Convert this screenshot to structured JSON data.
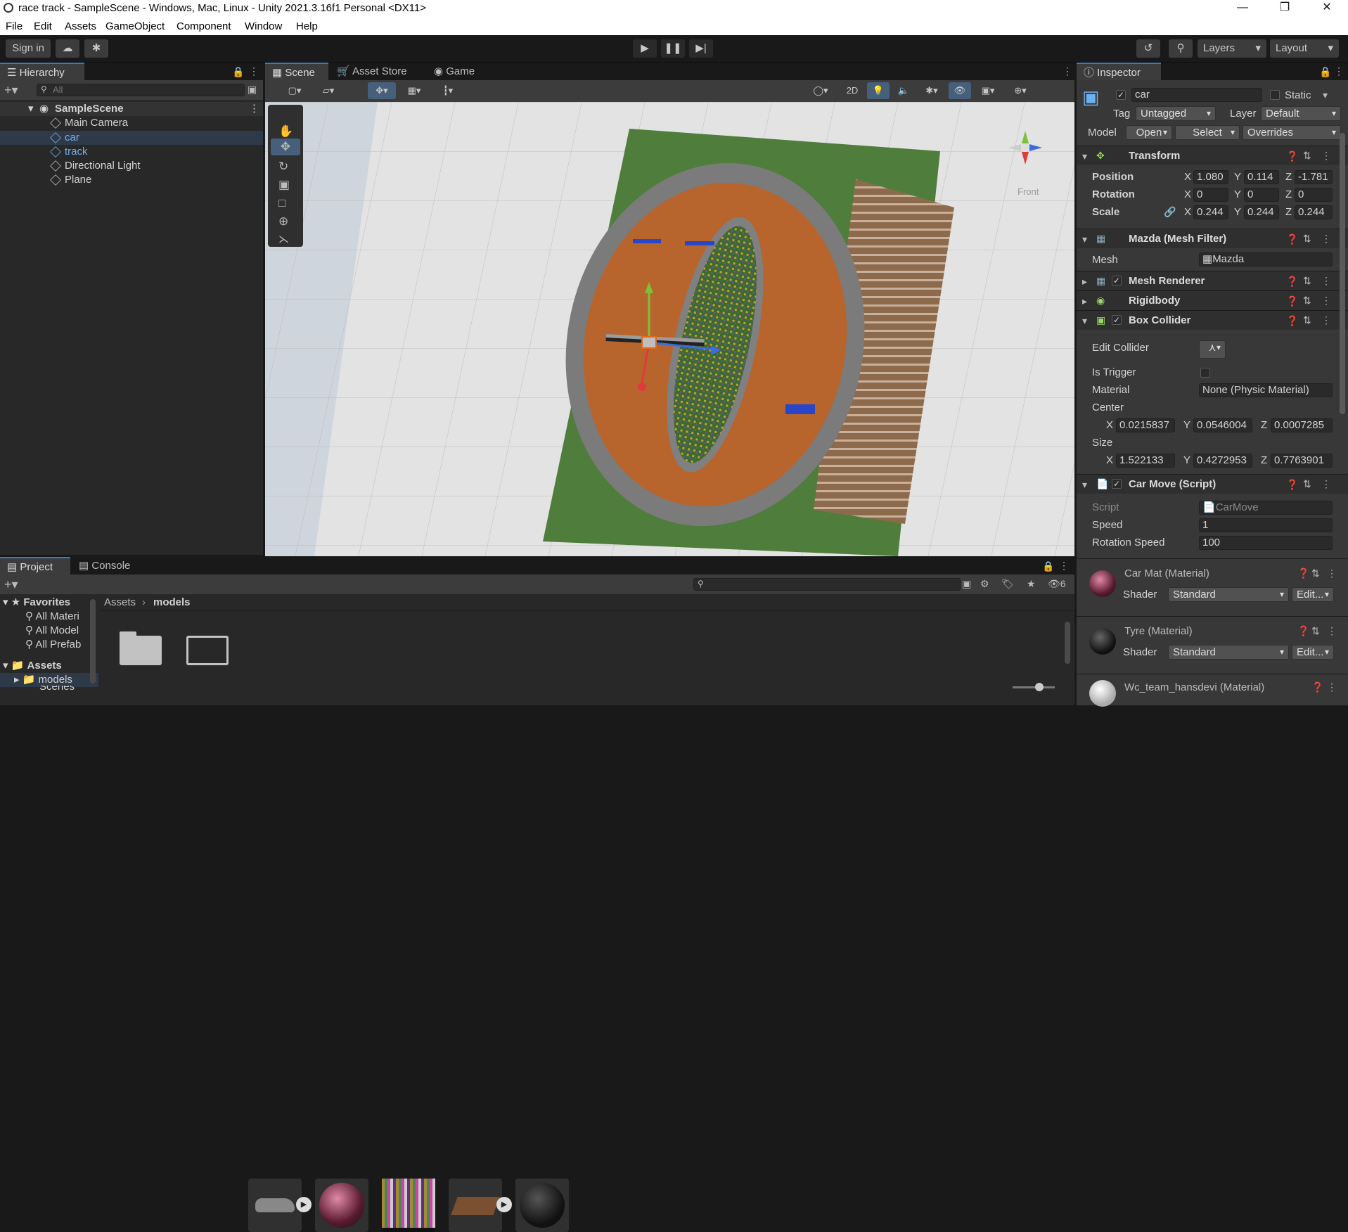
{
  "window": {
    "title": "race track - SampleScene - Windows, Mac, Linux - Unity 2021.3.16f1 Personal <DX11>"
  },
  "menu": [
    "File",
    "Edit",
    "Assets",
    "GameObject",
    "Component",
    "Window",
    "Help"
  ],
  "toolbar": {
    "sign_in": "Sign in",
    "layers": "Layers",
    "layout": "Layout"
  },
  "hierarchy": {
    "tab": "Hierarchy",
    "search_placeholder": "All",
    "scene": "SampleScene",
    "items": [
      "Main Camera",
      "car",
      "track",
      "Directional Light",
      "Plane"
    ]
  },
  "scene_tabs": [
    "Scene",
    "Asset Store",
    "Game"
  ],
  "scene_toolbar": {
    "mode_2d": "2D",
    "gizmo_label": "Front"
  },
  "inspector": {
    "tab": "Inspector",
    "object_name": "car",
    "static_label": "Static",
    "tag_label": "Tag",
    "tag_value": "Untagged",
    "layer_label": "Layer",
    "layer_value": "Default",
    "model_label": "Model",
    "open": "Open",
    "select": "Select",
    "overrides": "Overrides",
    "transform": {
      "name": "Transform",
      "position_label": "Position",
      "rotation_label": "Rotation",
      "scale_label": "Scale",
      "position": [
        "1.080",
        "0.114",
        "-1.781"
      ],
      "rotation": [
        "0",
        "0",
        "0"
      ],
      "scale": [
        "0.244",
        "0.244",
        "0.244"
      ]
    },
    "mesh_filter": {
      "name": "Mazda (Mesh Filter)",
      "mesh_label": "Mesh",
      "mesh_value": "Mazda"
    },
    "mesh_renderer": "Mesh Renderer",
    "rigidbody": "Rigidbody",
    "box_collider": {
      "name": "Box Collider",
      "edit_collider": "Edit Collider",
      "is_trigger": "Is Trigger",
      "material_label": "Material",
      "material_value": "None (Physic Material)",
      "center_label": "Center",
      "center": [
        "0.0215837",
        "0.0546004",
        "0.0007285"
      ],
      "size_label": "Size",
      "size": [
        "1.522133",
        "0.4272953",
        "0.7763901"
      ]
    },
    "car_move": {
      "name": "Car Move (Script)",
      "script_label": "Script",
      "script_value": "CarMove",
      "speed_label": "Speed",
      "speed_value": "1",
      "rotation_speed_label": "Rotation Speed",
      "rotation_speed_value": "100"
    },
    "materials": [
      {
        "name": "Car Mat (Material)",
        "shader_label": "Shader",
        "shader": "Standard",
        "edit": "Edit..."
      },
      {
        "name": "Tyre (Material)",
        "shader_label": "Shader",
        "shader": "Standard",
        "edit": "Edit..."
      },
      {
        "name": "Wc_team_hansdevi (Material)"
      }
    ]
  },
  "project": {
    "tabs": [
      "Project",
      "Console"
    ],
    "hidden_count": "6",
    "favorites_label": "Favorites",
    "favorites": [
      "All Materi",
      "All Model",
      "All Prefab"
    ],
    "assets_label": "Assets",
    "assets_children": [
      "models",
      "Scenes"
    ],
    "breadcrumb": [
      "Assets",
      "models"
    ]
  }
}
